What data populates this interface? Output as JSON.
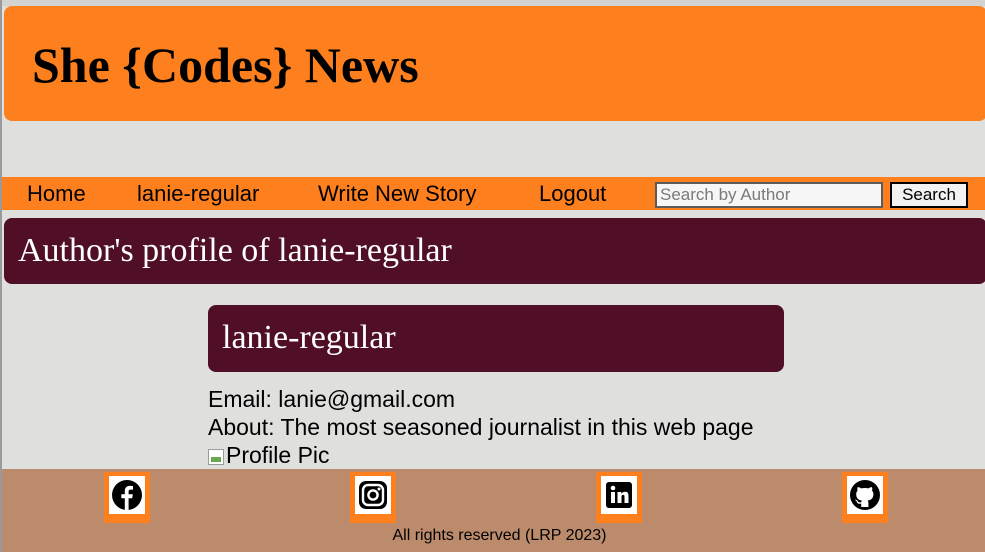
{
  "header": {
    "site_title": "She {Codes} News"
  },
  "nav": {
    "items": [
      {
        "label": "Home"
      },
      {
        "label": "lanie-regular"
      },
      {
        "label": "Write New Story"
      },
      {
        "label": "Logout"
      }
    ],
    "search": {
      "placeholder": "Search by Author",
      "value": "",
      "button_label": "Search"
    }
  },
  "profile": {
    "heading": "Author's profile of lanie-regular",
    "username": "lanie-regular",
    "email_line": "Email: lanie@gmail.com",
    "about_line": "About: The most seasoned journalist in this web page",
    "image_alt": "Profile Pic"
  },
  "footer": {
    "social_icons": [
      "facebook-icon",
      "instagram-icon",
      "linkedin-icon",
      "github-icon"
    ],
    "copyright": "All rights reserved (LRP 2023)"
  },
  "colors": {
    "accent_orange": "#fd7f1d",
    "banner_maroon": "#510f27",
    "footer_brown": "#bc8b6c",
    "page_background": "#dfe0de"
  }
}
